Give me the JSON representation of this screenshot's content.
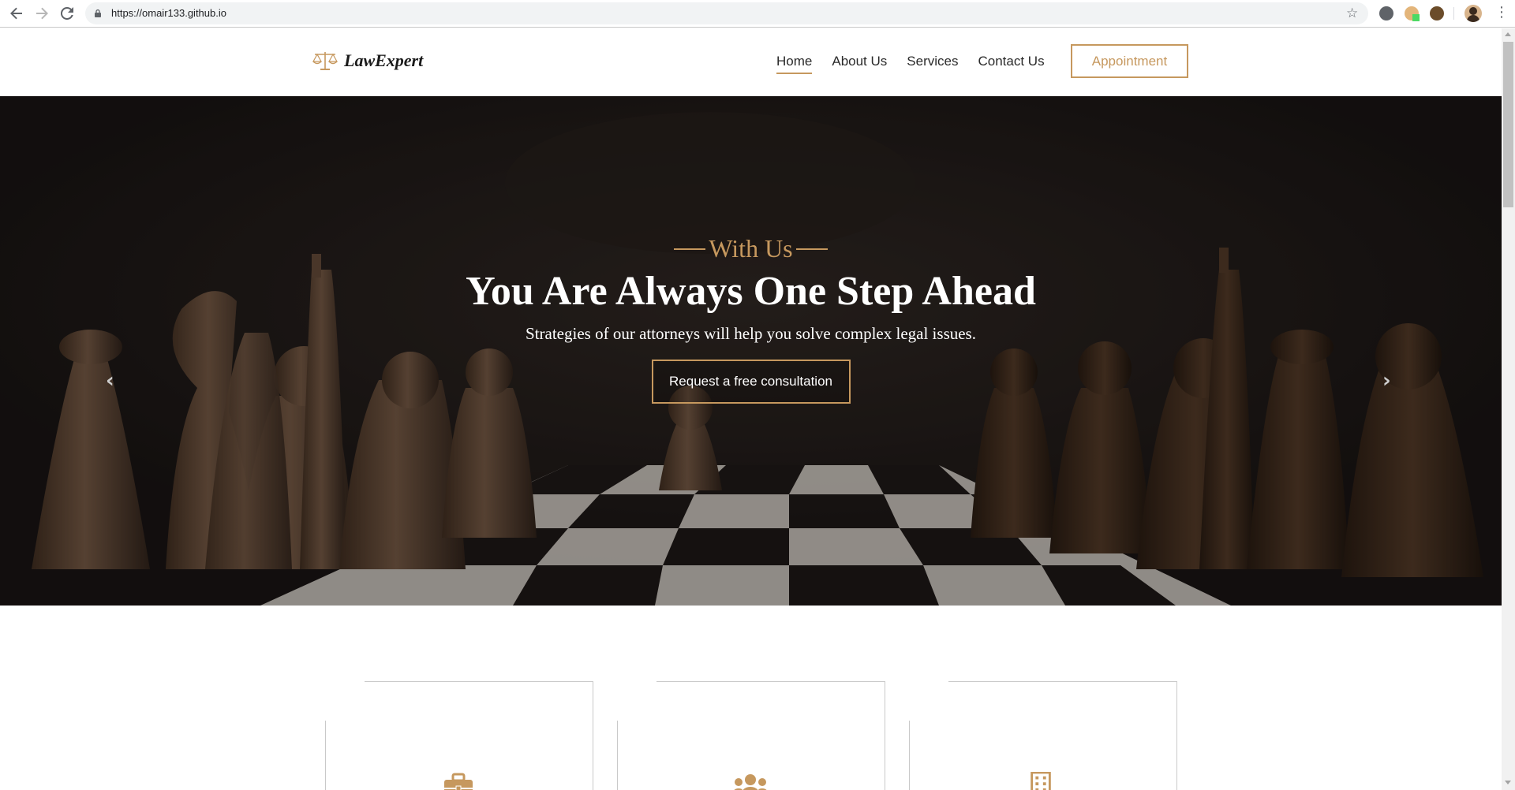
{
  "browser": {
    "url": "https://omair133.github.io",
    "back_icon": "arrow-left-icon",
    "forward_icon": "arrow-right-icon",
    "reload_icon": "reload-icon",
    "bookmark_icon": "star-icon",
    "menu_icon": "kebab-menu-icon"
  },
  "site": {
    "brand": "LawExpert",
    "nav": [
      {
        "label": "Home",
        "active": true
      },
      {
        "label": "About Us",
        "active": false
      },
      {
        "label": "Services",
        "active": false
      },
      {
        "label": "Contact Us",
        "active": false
      }
    ],
    "appointment_label": "Appointment",
    "hero": {
      "eyebrow": "With Us",
      "title": "You Are Always One Step Ahead",
      "subtitle": "Strategies of our attorneys will help you solve complex legal issues.",
      "cta": "Request a free consultation",
      "prev_icon": "chevron-left-icon",
      "next_icon": "chevron-right-icon"
    },
    "features": [
      {
        "icon": "briefcase-icon"
      },
      {
        "icon": "users-icon"
      },
      {
        "icon": "building-icon"
      }
    ]
  },
  "colors": {
    "accent": "#c6985e",
    "text_dark": "#1a1a1a",
    "hero_dark": "#1b1612"
  }
}
